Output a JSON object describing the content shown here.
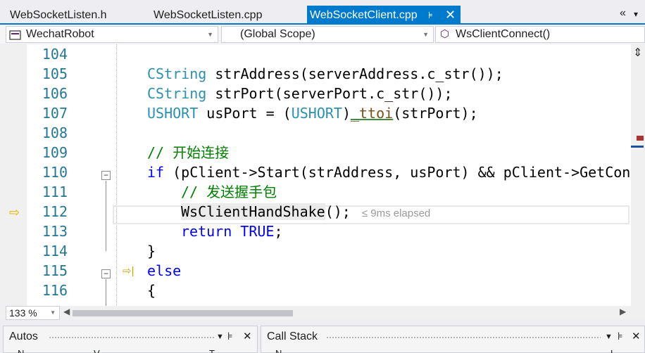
{
  "tabs": [
    {
      "label": "WebSocketListen.h",
      "active": false
    },
    {
      "label": "WebSocketListen.cpp",
      "active": false
    },
    {
      "label": "WebSocketClient.cpp",
      "active": true
    }
  ],
  "tab_controls": {
    "pin": "⊧",
    "close": "✕",
    "overflow": "«",
    "menu": "▾"
  },
  "navbar": {
    "project": "WechatRobot",
    "scope": "(Global Scope)",
    "member": "WsClientConnect()",
    "member_icon": "cube-icon"
  },
  "editor": {
    "lines": [
      {
        "num": "104"
      },
      {
        "num": "105"
      },
      {
        "num": "106"
      },
      {
        "num": "107"
      },
      {
        "num": "108"
      },
      {
        "num": "109"
      },
      {
        "num": "110"
      },
      {
        "num": "111"
      },
      {
        "num": "112"
      },
      {
        "num": "113"
      },
      {
        "num": "114"
      },
      {
        "num": "115"
      },
      {
        "num": "116"
      }
    ],
    "code": {
      "l105_type": "CString",
      "l105_rest": " strAddress(serverAddress.c_str());",
      "l106_type": "CString",
      "l106_rest": " strPort(serverPort.c_str());",
      "l107_type": "USHORT",
      "l107_mid": " usPort = (",
      "l107_type2": "USHORT",
      "l107_mid2": ")",
      "l107_fn": "_ttoi",
      "l107_rest": "(strPort);",
      "l109_comment": "// 开始连接",
      "l110_kw": "if",
      "l110_rest": " (pClient->Start(strAddress, usPort) && pClient->GetConn",
      "l111_comment": "// 发送握手包",
      "l112_call": "WsClientHandShake",
      "l112_rest": "();",
      "l112_hint": "≤ 9ms elapsed",
      "l113_kw": "return",
      "l113_val": "TRUE",
      "l113_rest": ";",
      "l114_text": "}",
      "l115_kw": "else",
      "l116_text": "{"
    }
  },
  "zoom": {
    "value": "133 %"
  },
  "panes": [
    {
      "title": "Autos",
      "cols": [
        "N",
        "V",
        "T"
      ]
    },
    {
      "title": "Call Stack",
      "cols": [
        "N",
        "L"
      ]
    }
  ],
  "colors": {
    "accent": "#007acc",
    "keyword": "#0000ff",
    "type": "#2b91af",
    "comment": "#008000",
    "line_number": "#237893"
  }
}
